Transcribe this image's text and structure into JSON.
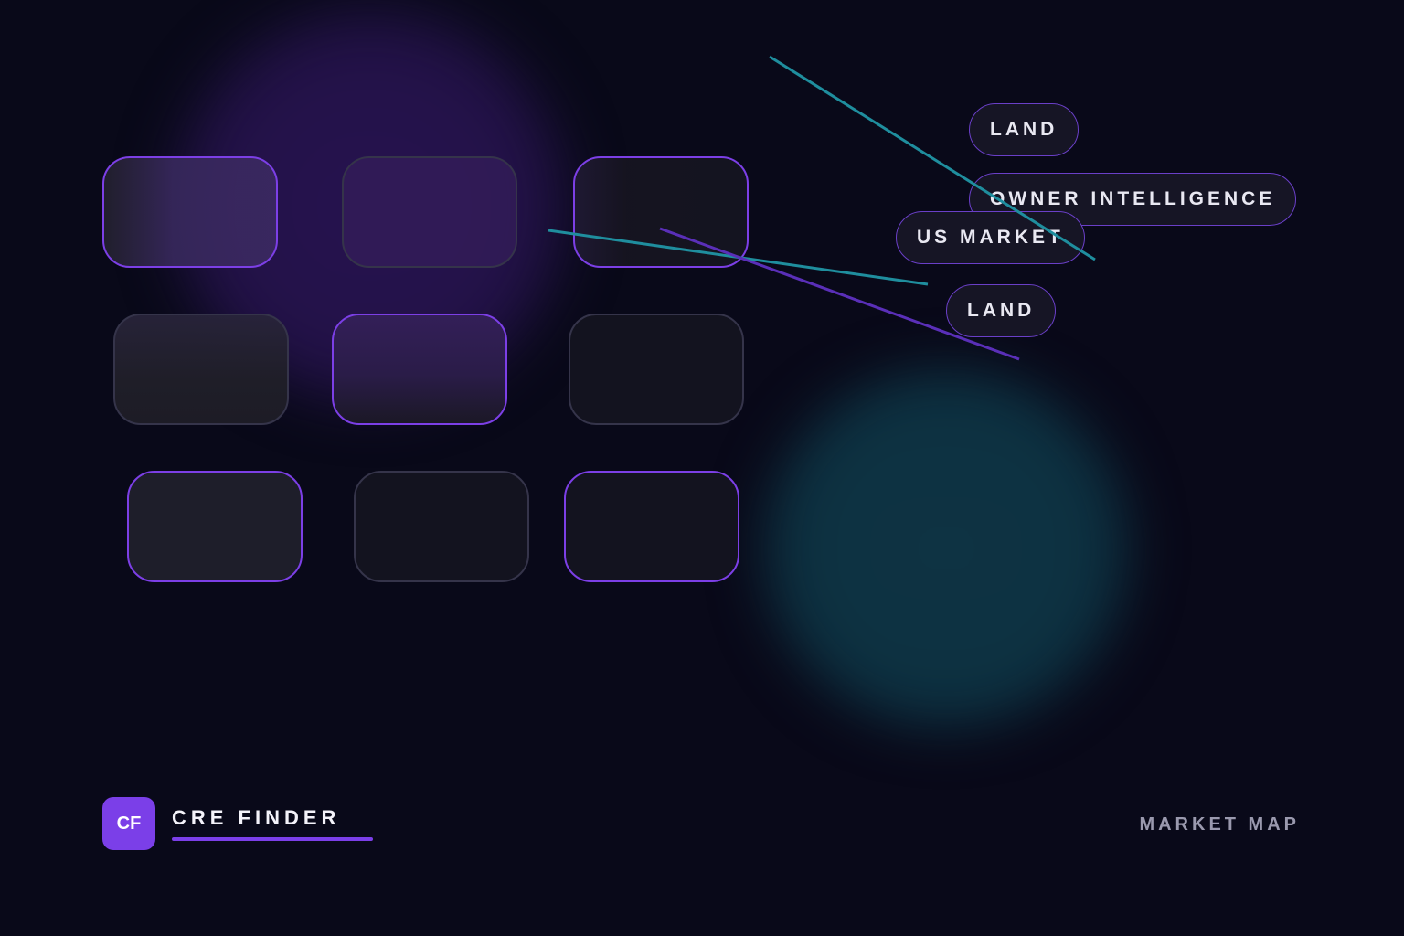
{
  "colors": {
    "background": "#090919",
    "accent_purple": "#7b3fe8",
    "accent_teal": "#1f8e9e",
    "purple_glow": "#26124f",
    "teal_glow": "#0e3343"
  },
  "tags": [
    {
      "label": "LAND"
    },
    {
      "label": "OWNER INTELLIGENCE"
    },
    {
      "label": "US MARKET"
    },
    {
      "label": "LAND"
    }
  ],
  "brand": {
    "badge": "CF",
    "name": "CRE FINDER"
  },
  "footer": {
    "section_label": "MARKET MAP"
  }
}
